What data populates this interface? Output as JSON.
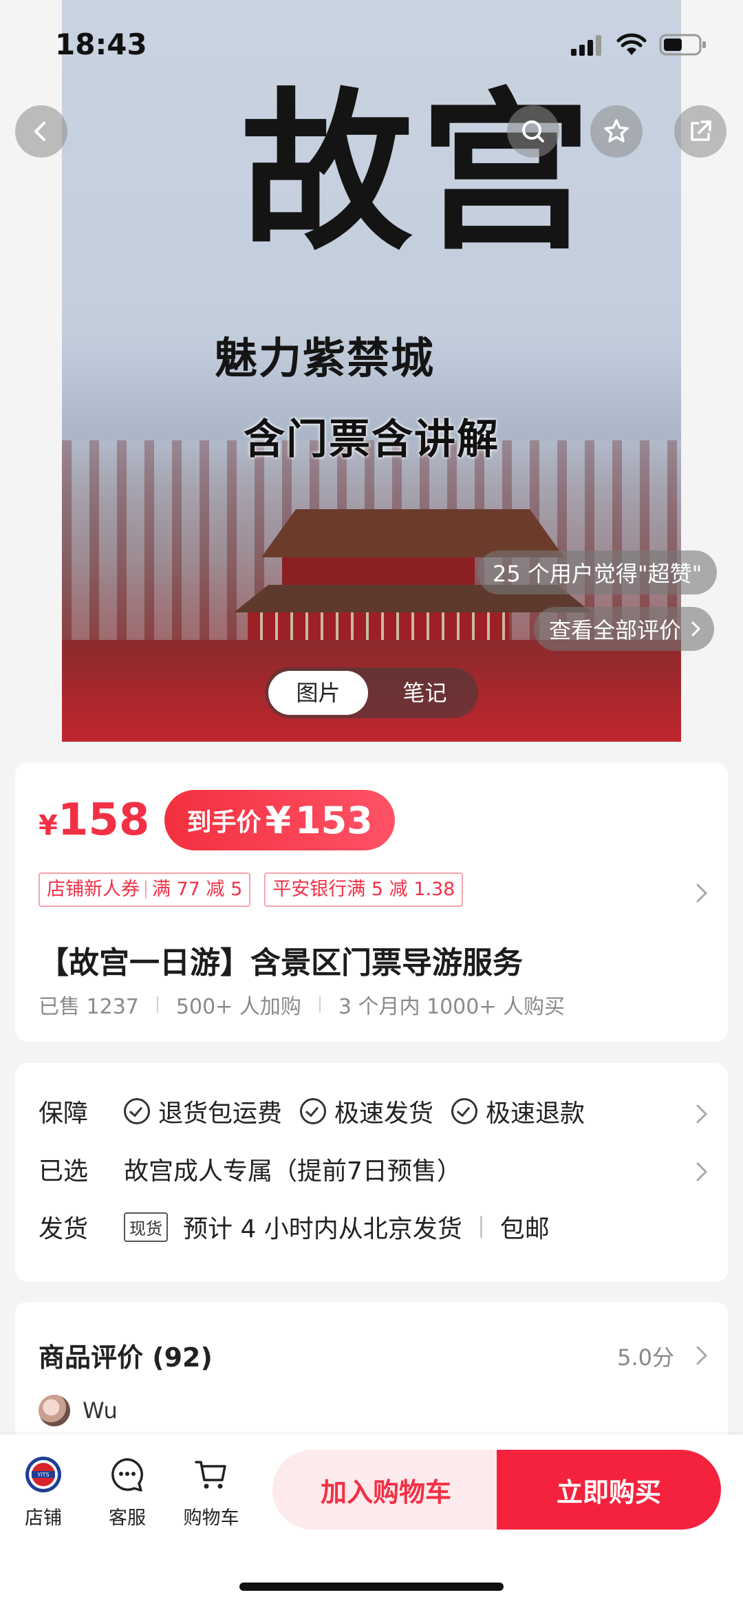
{
  "status_bar": {
    "time": "18:43"
  },
  "hero": {
    "title": "故宫",
    "subtitle": "魅力紫禁城",
    "caption": "含门票含讲解",
    "likes_text": "25 个用户觉得\"超赞\"",
    "view_all_reviews": "查看全部评价",
    "tabs": [
      {
        "label": "图片",
        "active": true
      },
      {
        "label": "笔记",
        "active": false
      }
    ]
  },
  "price": {
    "currency": "¥",
    "value": "158",
    "final_label": "到手价",
    "final_currency": "¥",
    "final_value": "153",
    "coupons": [
      {
        "parts": [
          "店铺新人券",
          "满 77 减 5"
        ]
      },
      {
        "parts": [
          "平安银行满 5 减 1.38"
        ]
      }
    ]
  },
  "product": {
    "title": "【故宫一日游】含景区门票导游服务",
    "stats": [
      "已售 1237",
      "500+ 人加购",
      "3 个月内 1000+ 人购买"
    ]
  },
  "service": {
    "guarantee_label": "保障",
    "guarantees": [
      "退货包运费",
      "极速发货",
      "极速退款"
    ],
    "selected_label": "已选",
    "selected_value": "故宫成人专属（提前7日预售）",
    "shipping_label": "发货",
    "shipping_tag": "现货",
    "shipping_text": "预计 4 小时内从北京发货",
    "shipping_extra": "包邮"
  },
  "reviews": {
    "title": "商品评价 (92)",
    "score": "5.0分",
    "first_reviewer": "Wu"
  },
  "bottom_bar": {
    "shop": "店铺",
    "service": "客服",
    "cart": "购物车",
    "add_to_cart": "加入购物车",
    "buy_now": "立即购买",
    "shop_logo_text": "YITS"
  },
  "colors": {
    "accent": "#f23045",
    "buy": "#f5223d",
    "cart_bg": "#fdeaec"
  }
}
